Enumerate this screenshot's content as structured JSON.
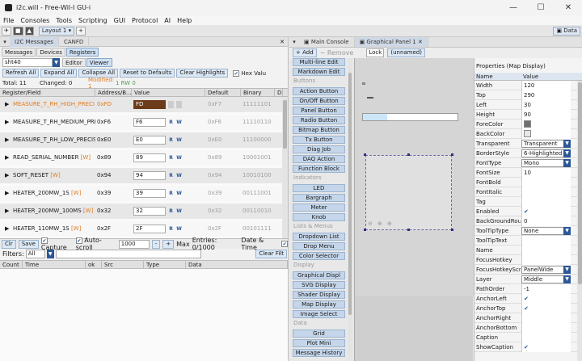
{
  "window": {
    "title": "i2c.will - Free-Wil-I GU-i",
    "min": "—",
    "max": "☐",
    "close": "✕"
  },
  "menu": [
    "File",
    "Consoles",
    "Tools",
    "Scripting",
    "GUI",
    "Protocol",
    "AI",
    "Help"
  ],
  "toolbar": {
    "layout": "Layout 1",
    "data": "Data"
  },
  "left_tabs": [
    "I2C Messages",
    "CANFD"
  ],
  "left_close": "✕",
  "subtabs": [
    "Messages",
    "Devices",
    "Registers"
  ],
  "device": {
    "value": "sht40",
    "editor": "Editor",
    "viewer": "Viewer"
  },
  "actions": {
    "refresh": "Refresh All",
    "expand": "Expand All",
    "collapse": "Collapse All",
    "reset": "Reset to Defaults",
    "clear": "Clear Highlights",
    "hex": "Hex Valu"
  },
  "stats": {
    "total": "Total: 11",
    "changed": "Changed: 0",
    "modified": "Modified: 1",
    "extra": "1 RW 0"
  },
  "reg_headers": [
    "Register/Field",
    "Address/B...",
    "Value",
    "Default",
    "Binary",
    "D"
  ],
  "registers": [
    {
      "name": "MEASURE_T_RH_HIGH_PRECI",
      "addr": "0xFD",
      "value": "FD",
      "default": "0xF7",
      "binary": "11111101",
      "highlight": true
    },
    {
      "name": "MEASURE_T_RH_MEDIUM_PRE",
      "addr": "0xF6",
      "value": "F6",
      "default": "0xF6",
      "binary": "11110110"
    },
    {
      "name": "MEASURE_T_RH_LOW_PRECIS",
      "addr": "0xE0",
      "value": "E0",
      "default": "0xE0",
      "binary": "11100000"
    },
    {
      "name": "READ_SERIAL_NUMBER",
      "tag": "[W]",
      "addr": "0x89",
      "value": "89",
      "default": "0x89",
      "binary": "10001001"
    },
    {
      "name": "SOFT_RESET",
      "tag": "[W]",
      "addr": "0x94",
      "value": "94",
      "default": "0x94",
      "binary": "10010100"
    },
    {
      "name": "HEATER_200MW_1S",
      "tag": "[W]",
      "addr": "0x39",
      "value": "39",
      "default": "0x39",
      "binary": "00111001"
    },
    {
      "name": "HEATER_200MW_100MS",
      "tag": "[W]",
      "addr": "0x32",
      "value": "32",
      "default": "0x32",
      "binary": "00110010"
    },
    {
      "name": "HEATER_110MW_1S",
      "tag": "[W]",
      "addr": "0x2F",
      "value": "2F",
      "default": "0x2F",
      "binary": "00101111"
    }
  ],
  "rw": {
    "r": "R",
    "w": "W"
  },
  "expander": "▶",
  "console": {
    "clr": "Clr",
    "save": "Save",
    "capture": "Capture",
    "autoscroll": "Auto-scroll",
    "autoscroll_val": "1000",
    "minus": "-",
    "plus": "+",
    "max": "Max",
    "entries": "Entries: 0/1000",
    "datetime": "Date & Time",
    "filters": "Filters:",
    "filter_val": "All",
    "clear_filter": "Clear Filt"
  },
  "msg_headers": [
    "Count",
    "Time",
    "ok",
    "Src",
    "Type",
    "Data"
  ],
  "mid_tabs": [
    "Main Console",
    "Graphical Panel 1"
  ],
  "mid_tab_close": "✕",
  "mid_toolbar": {
    "add": "+ Add",
    "remove": "− Remove",
    "lock": "Lock",
    "unnamed": "(unnamed)"
  },
  "widgets": {
    "top": [
      "Multi-line Edit",
      "Markdown Edit"
    ],
    "buttons_title": "Buttons",
    "buttons": [
      "Action Button",
      "On/Off Button",
      "Panel Button",
      "Radio Button",
      "Bitmap Button",
      "Tx Button",
      "Diag Job",
      "DAQ Action",
      "Function Block"
    ],
    "indicators_title": "Indicators",
    "indicators": [
      "LED",
      "Bargraph",
      "Meter",
      "Knob"
    ],
    "lists_title": "Lists & Menus",
    "lists": [
      "Dropdown List",
      "Drop Menu",
      "Color Selector"
    ],
    "display_title": "Display",
    "display": [
      "Graphical Displ",
      "SVG Display",
      "Shader Display",
      "Map Display",
      "Image Select"
    ],
    "data_title": "Data",
    "data": [
      "Grid",
      "Plot Mini",
      "Message History"
    ]
  },
  "props": {
    "title": "Properties (Map Display)",
    "header": [
      "Name",
      "Value"
    ],
    "rows": [
      {
        "n": "Width",
        "v": "120"
      },
      {
        "n": "Top",
        "v": "290"
      },
      {
        "n": "Left",
        "v": "30"
      },
      {
        "n": "Height",
        "v": "90"
      },
      {
        "n": "ForeColor",
        "v": "",
        "color": "#6e6e6e"
      },
      {
        "n": "BackColor",
        "v": "",
        "color": "#e6e6e6"
      },
      {
        "n": "Transparent",
        "v": "Transparent",
        "dd": true
      },
      {
        "n": "BorderStyle",
        "v": "6-Highlighted",
        "dd": true
      },
      {
        "n": "FontType",
        "v": "Mono",
        "dd": true
      },
      {
        "n": "FontSize",
        "v": "10"
      },
      {
        "n": "FontBold",
        "v": ""
      },
      {
        "n": "FontItalic",
        "v": ""
      },
      {
        "n": "Tag",
        "v": ""
      },
      {
        "n": "Enabled",
        "v": "✔"
      },
      {
        "n": "BackGroundRou",
        "v": "0"
      },
      {
        "n": "ToolTipType",
        "v": "None",
        "dd": true
      },
      {
        "n": "ToolTipText",
        "v": ""
      },
      {
        "n": "Name",
        "v": ""
      },
      {
        "n": "FocusHotkey",
        "v": ""
      },
      {
        "n": "FocusHotkeyScr",
        "v": "PanelWide",
        "dd": true
      },
      {
        "n": "Layer",
        "v": "Middle",
        "dd": true
      },
      {
        "n": "PathOrder",
        "v": "-1"
      },
      {
        "n": "AnchorLeft",
        "v": "✔"
      },
      {
        "n": "AnchorTop",
        "v": "✔"
      },
      {
        "n": "AnchorRight",
        "v": ""
      },
      {
        "n": "AnchorBottom",
        "v": ""
      },
      {
        "n": "Caption",
        "v": ""
      },
      {
        "n": "ShowCaption",
        "v": "✔"
      }
    ]
  }
}
